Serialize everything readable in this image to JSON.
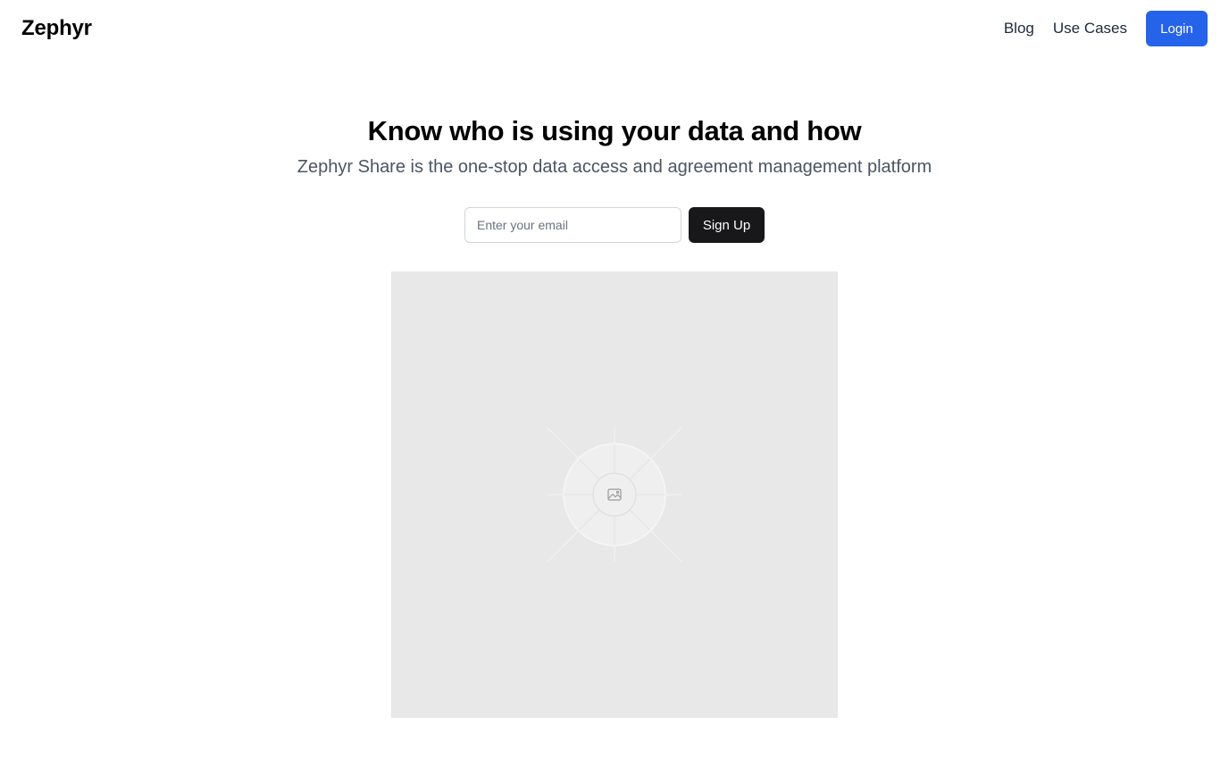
{
  "header": {
    "brand": "Zephyr",
    "nav": {
      "blog": "Blog",
      "use_cases": "Use Cases",
      "login": "Login"
    }
  },
  "hero": {
    "title": "Know who is using your data and how",
    "subtitle": "Zephyr Share is the one-stop data access and agreement management platform",
    "signup": {
      "email_placeholder": "Enter your email",
      "email_value": "",
      "button_label": "Sign Up"
    },
    "image": {
      "icon": "image-placeholder-icon"
    }
  },
  "colors": {
    "accent": "#2563eb",
    "dark_button": "#18181b",
    "placeholder_bg": "#e8e8e8"
  }
}
